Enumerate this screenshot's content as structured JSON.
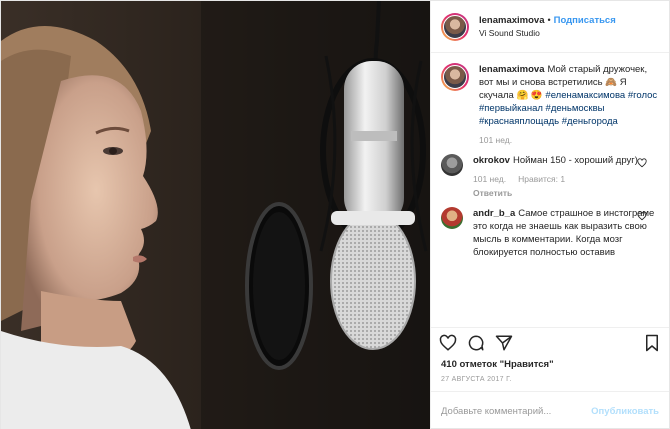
{
  "photo": {
    "alt": ""
  },
  "header": {
    "username": "lenamaximova",
    "separator": "•",
    "follow_label": "Подписаться",
    "location": "Vi Sound Studio"
  },
  "caption": {
    "username": "lenamaximova",
    "text": "Мой старый дружочек, вот мы и снова встретились 🙈 Я скучала 🤗 😍",
    "tags": "#еленамаксимова #голос #первыйканал #деньмосквы #краснаяплощадь #деньгорода",
    "time": "101 нед."
  },
  "comments": [
    {
      "username": "okrokov",
      "text": "Нойман 150 - хороший друг)",
      "time": "101 нед.",
      "likes": "Нравится: 1",
      "reply": "Ответить"
    },
    {
      "username": "andr_b_a",
      "text": "Самое страшное в инстограме это когда не знаешь как выразить свою мысль в комментарии. Когда мозг блокируется полностью оставив"
    }
  ],
  "likes_text": "410 отметок \"Нравится\"",
  "date": "27 АВГУСТА 2017 Г.",
  "add_comment": {
    "placeholder": "Добавьте комментарий...",
    "publish_label": "Опубликовать"
  },
  "icons": [
    "heart-icon",
    "comment-icon",
    "share-icon",
    "bookmark-icon"
  ],
  "colors": {
    "accent": "#3897f0",
    "publish_disabled": "#b2dffc",
    "muted": "#999999",
    "hashtag": "#003569"
  }
}
